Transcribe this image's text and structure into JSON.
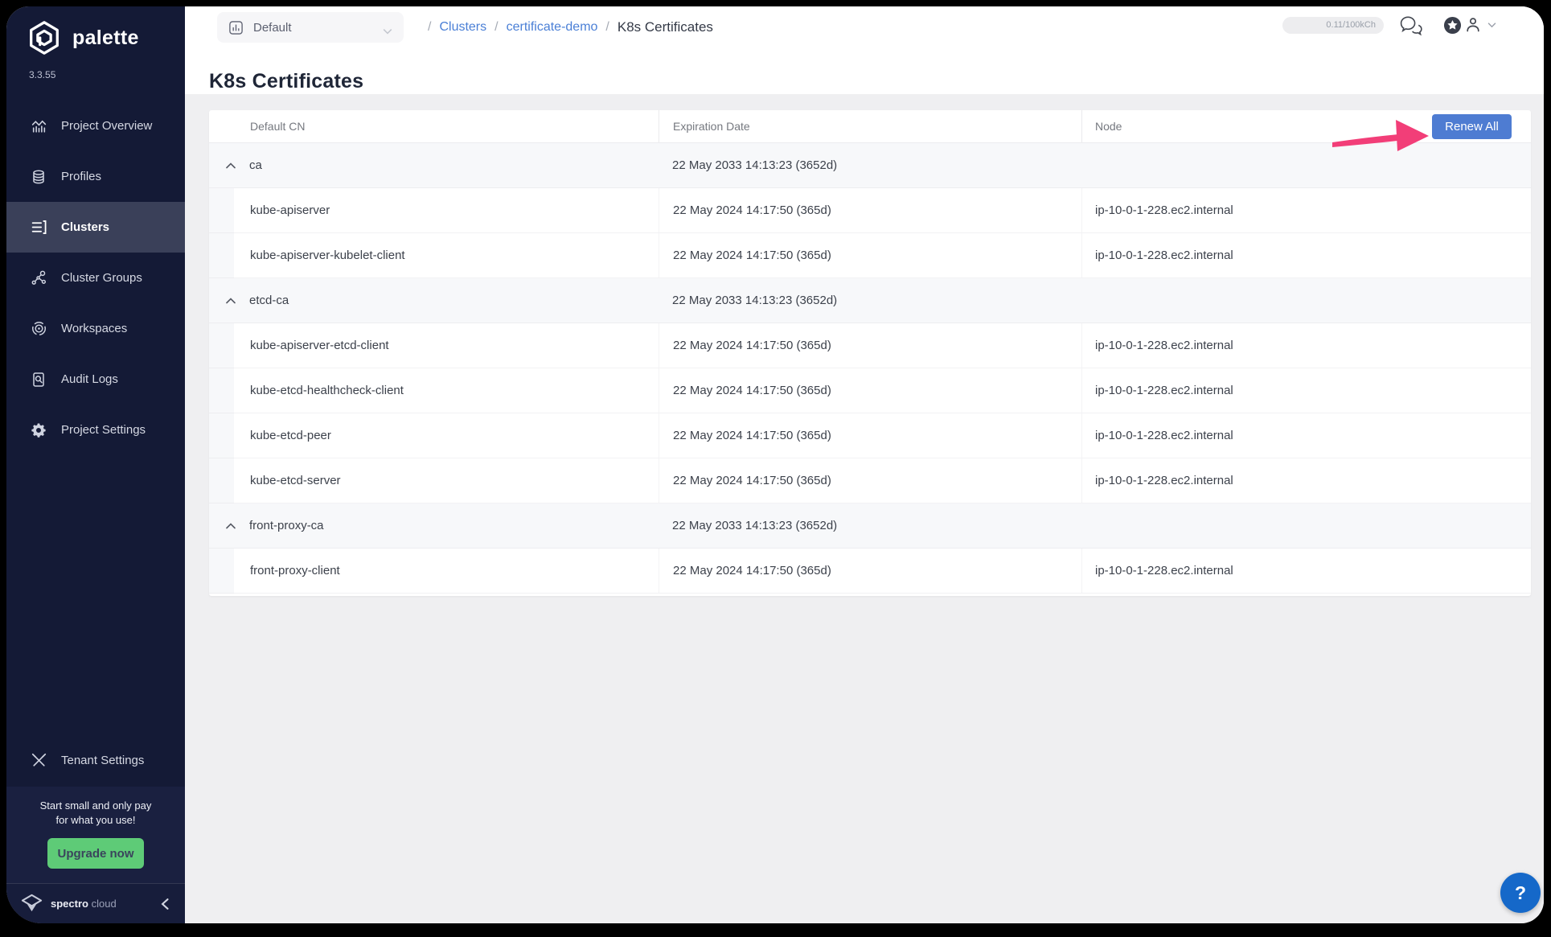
{
  "app": {
    "brand": "palette",
    "version": "3.3.55",
    "footer_brand_bold": "spectro",
    "footer_brand_light": "cloud"
  },
  "sidebar": {
    "items": [
      {
        "label": "Project Overview",
        "icon": "project-overview-icon",
        "active": false
      },
      {
        "label": "Profiles",
        "icon": "profiles-icon",
        "active": false
      },
      {
        "label": "Clusters",
        "icon": "clusters-icon",
        "active": true
      },
      {
        "label": "Cluster Groups",
        "icon": "cluster-groups-icon",
        "active": false
      },
      {
        "label": "Workspaces",
        "icon": "workspaces-icon",
        "active": false
      },
      {
        "label": "Audit Logs",
        "icon": "audit-logs-icon",
        "active": false
      },
      {
        "label": "Project Settings",
        "icon": "project-settings-icon",
        "active": false
      }
    ],
    "tenant_settings": {
      "label": "Tenant Settings",
      "icon": "tenant-settings-icon"
    },
    "promo": {
      "line1": "Start small and only pay",
      "line2": "for what you use!",
      "button_label": "Upgrade now"
    }
  },
  "topbar": {
    "project_selector_value": "Default",
    "breadcrumb": [
      {
        "label": "Clusters",
        "link": true
      },
      {
        "label": "certificate-demo",
        "link": true
      },
      {
        "label": "K8s Certificates",
        "link": false
      }
    ],
    "usage": "0.11/100kCh"
  },
  "page": {
    "title": "K8s Certificates"
  },
  "table": {
    "columns": [
      "Default CN",
      "Expiration Date",
      "Node"
    ],
    "renew_all_label": "Renew All",
    "groups": [
      {
        "name": "ca",
        "expiration": "22 May 2033 14:13:23 (3652d)",
        "children": [
          {
            "name": "kube-apiserver",
            "expiration": "22 May 2024 14:17:50 (365d)",
            "node": "ip-10-0-1-228.ec2.internal"
          },
          {
            "name": "kube-apiserver-kubelet-client",
            "expiration": "22 May 2024 14:17:50 (365d)",
            "node": "ip-10-0-1-228.ec2.internal"
          }
        ]
      },
      {
        "name": "etcd-ca",
        "expiration": "22 May 2033 14:13:23 (3652d)",
        "children": [
          {
            "name": "kube-apiserver-etcd-client",
            "expiration": "22 May 2024 14:17:50 (365d)",
            "node": "ip-10-0-1-228.ec2.internal"
          },
          {
            "name": "kube-etcd-healthcheck-client",
            "expiration": "22 May 2024 14:17:50 (365d)",
            "node": "ip-10-0-1-228.ec2.internal"
          },
          {
            "name": "kube-etcd-peer",
            "expiration": "22 May 2024 14:17:50 (365d)",
            "node": "ip-10-0-1-228.ec2.internal"
          },
          {
            "name": "kube-etcd-server",
            "expiration": "22 May 2024 14:17:50 (365d)",
            "node": "ip-10-0-1-228.ec2.internal"
          }
        ]
      },
      {
        "name": "front-proxy-ca",
        "expiration": "22 May 2033 14:13:23 (3652d)",
        "children": [
          {
            "name": "front-proxy-client",
            "expiration": "22 May 2024 14:17:50 (365d)",
            "node": "ip-10-0-1-228.ec2.internal"
          }
        ]
      }
    ]
  },
  "help": {
    "label": "?"
  },
  "colors": {
    "sidebar_bg": "#141a36",
    "active_item_bg": "#3a4059",
    "accent_blue": "#4e7cd2",
    "link_blue": "#4a7fd6",
    "green": "#5ecb77",
    "annotation_pink": "#f23e78",
    "help_blue": "#1568c9"
  }
}
